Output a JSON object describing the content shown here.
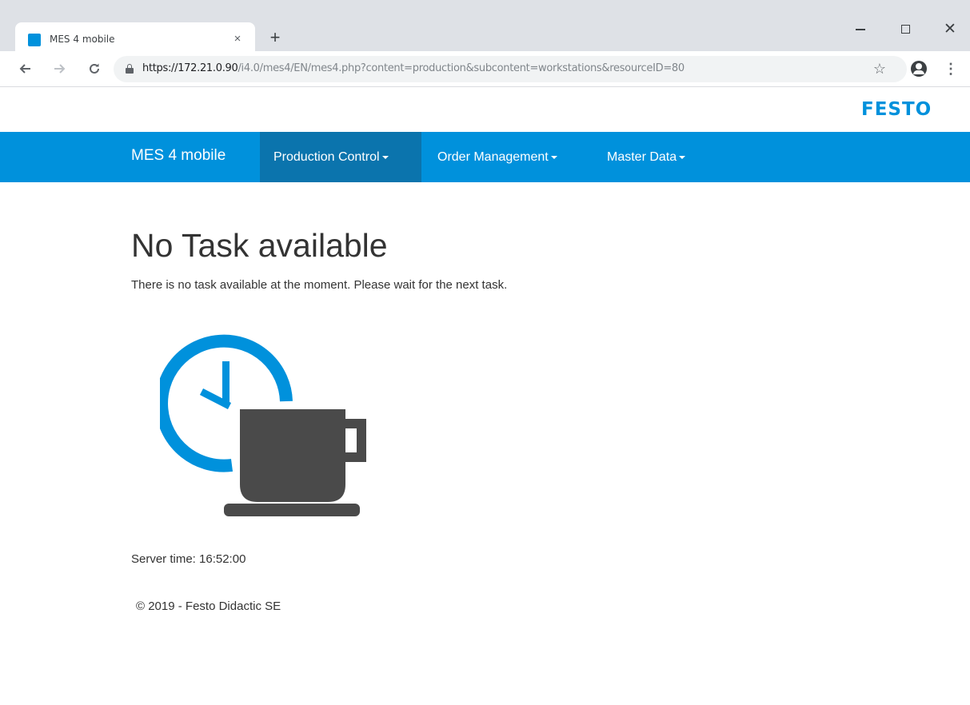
{
  "browser": {
    "tab_title": "MES 4 mobile",
    "tab_close": "×",
    "new_tab": "+",
    "window_close": "✕",
    "url_host": "https://172.21.0.90",
    "url_path": "/i4.0/mes4/EN/mes4.php?content=production&subcontent=workstations&resourceID=80"
  },
  "header": {
    "logo_text": "FESTO"
  },
  "navbar": {
    "brand": "MES 4 mobile",
    "items": [
      {
        "label": "Production Control",
        "active": true
      },
      {
        "label": "Order Management",
        "active": false
      },
      {
        "label": "Master Data",
        "active": false
      }
    ]
  },
  "main": {
    "title": "No Task available",
    "message": "There is no task available at the moment. Please wait for the next task.",
    "illustration_icon": "clock-coffee-cup-icon",
    "server_time": "Server time: 16:52:00",
    "copyright": "© 2019 - Festo Didactic SE"
  },
  "colors": {
    "brand_blue": "#0091dc",
    "active_nav": "#0b74ad",
    "cup_gray": "#4a4a4a"
  }
}
